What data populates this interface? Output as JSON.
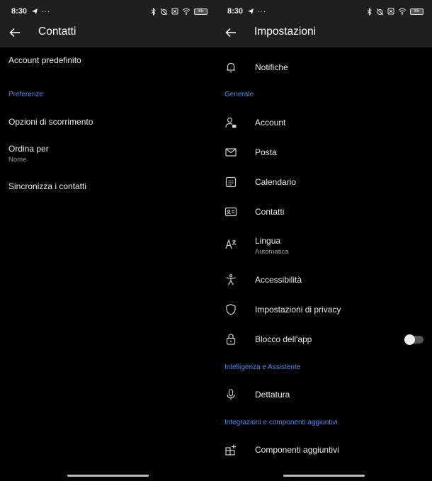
{
  "left": {
    "status": {
      "time": "8:30",
      "more": "···",
      "battery": "85"
    },
    "title": "Contatti",
    "items": {
      "default_account": "Account predefinito",
      "section_preferences": "Preferenze",
      "scroll_options": "Opzioni di scorrimento",
      "sort_by": "Ordina per",
      "sort_by_value": "Nome",
      "sync_contacts": "Sincronizza i contatti"
    }
  },
  "right": {
    "status": {
      "time": "8:30",
      "more": "···",
      "battery": "85"
    },
    "title": "Impostazioni",
    "items": {
      "notifications": "Notifiche",
      "section_general": "Generale",
      "account": "Account",
      "mail": "Posta",
      "calendar": "Calendario",
      "contacts": "Contatti",
      "language": "Lingua",
      "language_value": "Automatica",
      "accessibility": "Accessibilità",
      "privacy": "Impostazioni di privacy",
      "app_lock": "Blocco dell'app",
      "section_ai": "Intelligenza e Assistente",
      "dictation": "Dettatura",
      "section_integrations": "Integrazioni e componenti aggiuntivi",
      "addins": "Componenti aggiuntivi"
    },
    "app_lock_enabled": false
  },
  "colors": {
    "accent": "#4f8ee8",
    "background": "#000000",
    "topbar": "#1f1f1f"
  },
  "icons": [
    "arrow-left-icon",
    "bell-icon",
    "account-icon",
    "mail-icon",
    "calendar-icon",
    "contact-card-icon",
    "language-icon",
    "accessibility-icon",
    "shield-icon",
    "lock-icon",
    "microphone-icon",
    "addins-icon"
  ]
}
